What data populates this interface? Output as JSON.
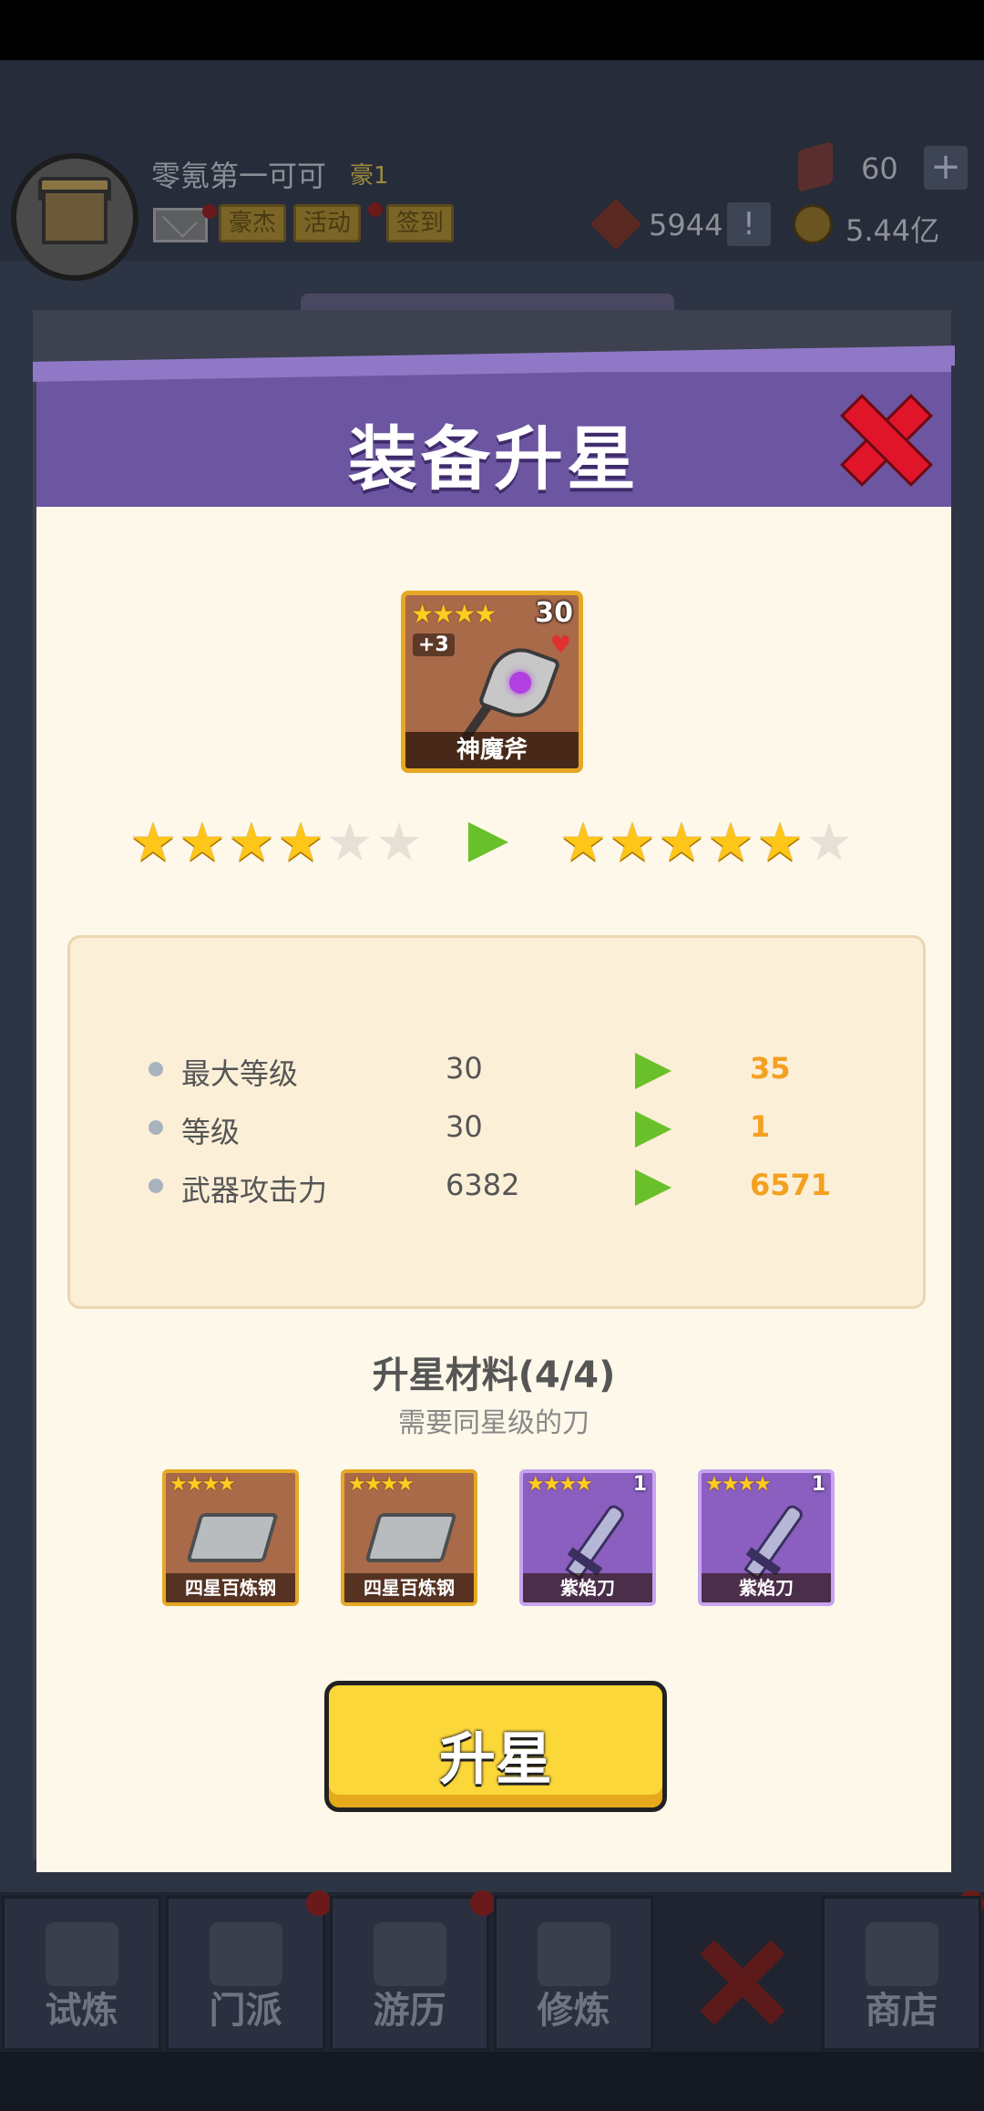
{
  "topbar": {
    "player_name": "零氪第一可可",
    "rank": "豪1",
    "buttons": [
      "豪杰",
      "活动",
      "签到"
    ],
    "gems": "60",
    "jade": "5944",
    "coins": "5.44亿"
  },
  "navbar": {
    "items": [
      {
        "label": "试炼",
        "icon": "trial-icon"
      },
      {
        "label": "门派",
        "icon": "sect-icon"
      },
      {
        "label": "游历",
        "icon": "travel-icon"
      },
      {
        "label": "修炼",
        "icon": "cultivate-icon"
      },
      {
        "label": "商店",
        "icon": "shop-icon"
      }
    ]
  },
  "modal": {
    "title": "装备升星",
    "equipment": {
      "name": "神魔斧",
      "stars": 4,
      "level": "30",
      "refine": "+3"
    },
    "star_upgrade": {
      "current": 4,
      "next": 5,
      "max": 6
    },
    "stats": [
      {
        "label": "最大等级",
        "old": "30",
        "new": "35"
      },
      {
        "label": "等级",
        "old": "30",
        "new": "1"
      },
      {
        "label": "武器攻击力",
        "old": "6382",
        "new": "6571"
      }
    ],
    "materials_title": "升星材料(4/4)",
    "materials_sub": "需要同星级的刀",
    "materials": [
      {
        "name": "四星百炼钢",
        "stars": 4,
        "qty": ""
      },
      {
        "name": "四星百炼钢",
        "stars": 4,
        "qty": ""
      },
      {
        "name": "紫焰刀",
        "stars": 4,
        "qty": "1"
      },
      {
        "name": "紫焰刀",
        "stars": 4,
        "qty": "1"
      }
    ],
    "upgrade_label": "升星"
  },
  "colors": {
    "header_purple": "#6c55a1",
    "panel_cream": "#fdf8e9",
    "star_gold": "#ffc61a",
    "arrow_green": "#6ac02a",
    "stat_new_orange": "#f4a020",
    "button_yellow": "#fcd73a",
    "close_red": "#e0152a"
  }
}
